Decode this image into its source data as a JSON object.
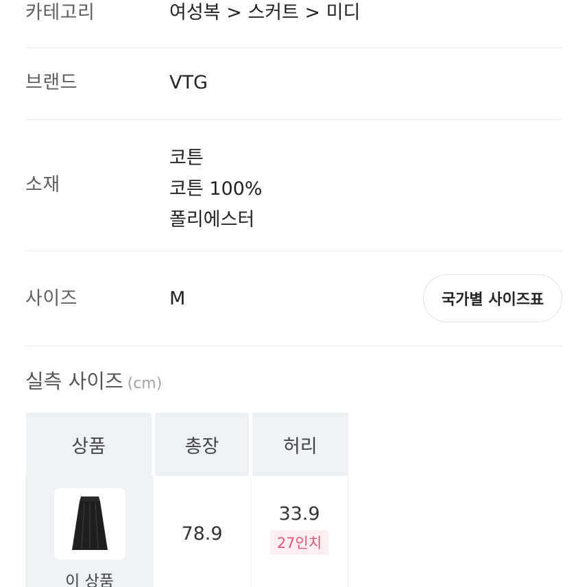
{
  "details": {
    "category": {
      "label": "카테고리",
      "value": "여성복 > 스커트 > 미디"
    },
    "brand": {
      "label": "브랜드",
      "value": "VTG"
    },
    "material": {
      "label": "소재",
      "values": [
        "코튼",
        "코튼 100%",
        "폴리에스터"
      ]
    },
    "size": {
      "label": "사이즈",
      "value": "M",
      "chart_button": "국가별 사이즈표"
    }
  },
  "measurements": {
    "title": "실측 사이즈",
    "unit": "(cm)",
    "headers": [
      "상품",
      "총장",
      "허리"
    ],
    "row": {
      "product_label": "이 상품",
      "thumbnail_icon": "black-midi-skirt-image",
      "total_length": "78.9",
      "waist": "33.9",
      "waist_inch": "27인치"
    }
  },
  "colors": {
    "inch_badge_text": "#e0557a",
    "inch_badge_bg": "#fdeef2",
    "header_bg": "#eef1f5"
  }
}
